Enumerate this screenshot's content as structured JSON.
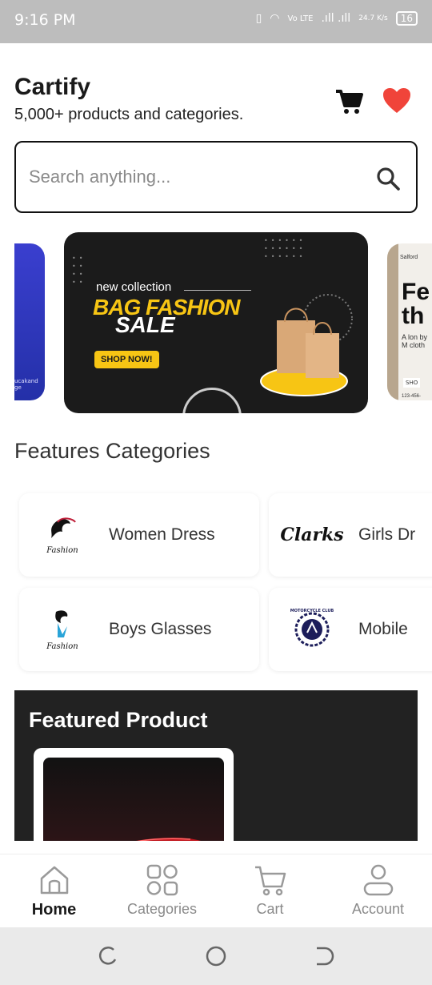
{
  "status_bar": {
    "time": "9:16 PM",
    "net_speed": "24.7 K/s",
    "battery": "16",
    "volte": "Vo LTE"
  },
  "header": {
    "title": "Cartify",
    "subtitle": "5,000+ products and categories."
  },
  "icons": {
    "cart": "cart-icon",
    "favorites": "heart-icon",
    "search": "search-icon"
  },
  "search": {
    "placeholder": "Search anything..."
  },
  "banners": {
    "left_small_text": "ucakand ge",
    "main": {
      "line1": "new collection",
      "line2": "BAG FASHION",
      "line3": "SALE",
      "cta": "SHOP NOW!"
    },
    "right": {
      "brand": "Salford",
      "big": "Fe th",
      "small": "A lon by M cloth",
      "cta": "SHO",
      "phone": "123-456-"
    }
  },
  "section_title": "Features Categories",
  "categories": [
    {
      "label": "Women Dress",
      "logo": "Fashion"
    },
    {
      "label": "Girls Dr",
      "logo": "Clarks"
    },
    {
      "label": "Boys Glasses",
      "logo": "Fashion"
    },
    {
      "label": "Mobile",
      "logo": "MOTORCYCLE CLUB"
    }
  ],
  "featured": {
    "title": "Featured Product"
  },
  "bottom_nav": [
    {
      "label": "Home",
      "icon": "home-icon",
      "active": true
    },
    {
      "label": "Categories",
      "icon": "grid-icon",
      "active": false
    },
    {
      "label": "Cart",
      "icon": "cart-icon",
      "active": false
    },
    {
      "label": "Account",
      "icon": "user-icon",
      "active": false
    }
  ],
  "colors": {
    "accent_heart": "#f0443a",
    "banner_yellow": "#f7c514",
    "featured_bg": "#222222"
  }
}
